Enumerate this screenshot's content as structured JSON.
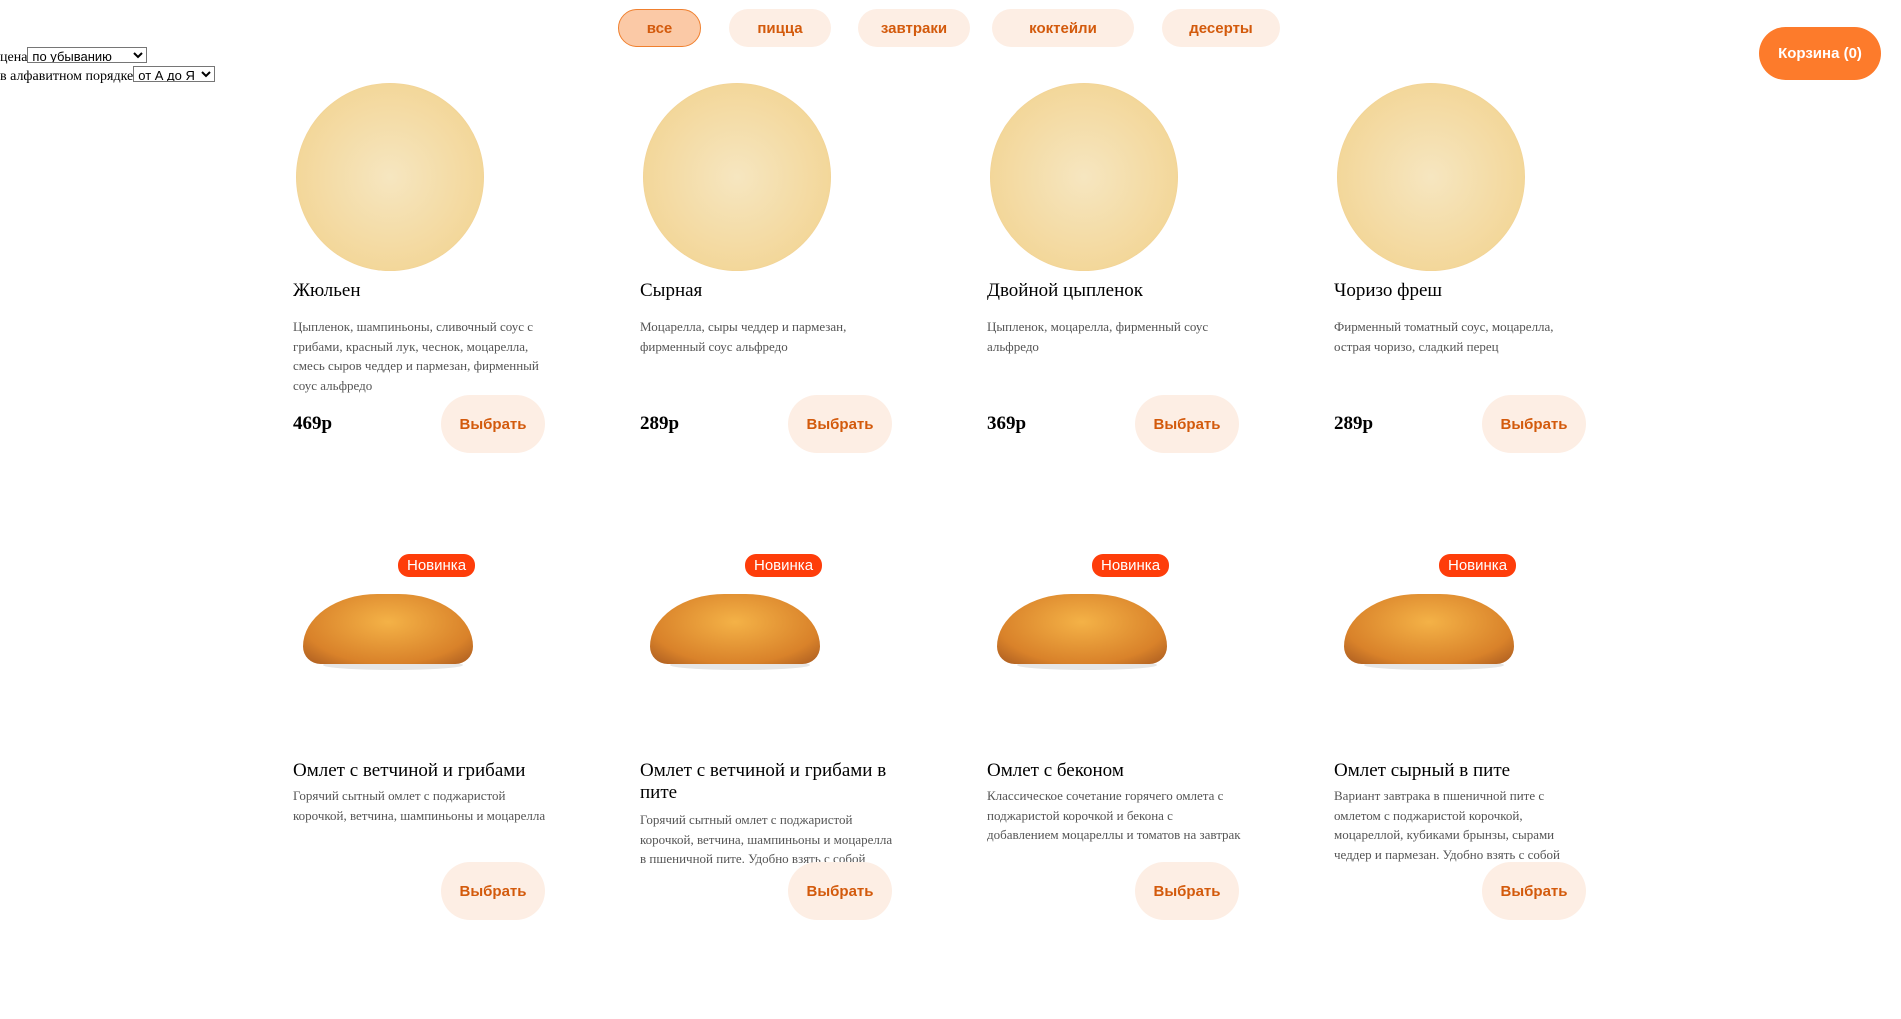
{
  "tabs": [
    {
      "label": "все",
      "active": true
    },
    {
      "label": "пицца"
    },
    {
      "label": "завтраки"
    },
    {
      "label": "коктейли"
    },
    {
      "label": "десерты"
    }
  ],
  "cart": {
    "label": "Корзина (0)"
  },
  "sort": {
    "price_label": "цена",
    "price_value": "по убыванию",
    "alpha_label": "в алфавитном порядке",
    "alpha_value": "от А до Я"
  },
  "colors": {
    "accent": "#fd7b2b",
    "button_bg": "#fdeee4",
    "button_text": "#d35a0c",
    "badge": "#fe3d0a"
  },
  "products": [
    {
      "title": "Жюльен",
      "desc": "Цыпленок, шампиньоны, сливочный соус с грибами, красный лук, чеснок, моцарелла, смесь сыров чеддер и пармезан, фирменный соус альфредо",
      "price": "469р",
      "button": "Выбрать",
      "image": "pizza"
    },
    {
      "title": "Сырная",
      "desc": "Моцарелла, сыры чеддер и пармезан, фирменный соус альфредо",
      "price": "289р",
      "button": "Выбрать",
      "image": "pizza"
    },
    {
      "title": "Двойной цыпленок",
      "desc": "Цыпленок, моцарелла, фирменный соус альфредо",
      "price": "369р",
      "button": "Выбрать",
      "image": "pizza"
    },
    {
      "title": "Чоризо фреш",
      "desc": "Фирменный томатный соус, моцарелла, острая чоризо, сладкий перец",
      "price": "289р",
      "button": "Выбрать",
      "image": "pizza"
    },
    {
      "title": "Омлет с ветчиной и грибами",
      "desc": "Горячий сытный омлет с поджаристой корочкой, ветчина, шампиньоны и моцарелла",
      "badge": "Новинка",
      "button": "Выбрать",
      "image": "omelet"
    },
    {
      "title": "Омлет с ветчиной и грибами в пите",
      "desc": "Горячий сытный омлет с поджаристой корочкой, ветчина, шампиньоны и моцарелла в пшеничной пите. Удобно взять с собой",
      "badge": "Новинка",
      "button": "Выбрать",
      "image": "omelet"
    },
    {
      "title": "Омлет с беконом",
      "desc": "Классическое сочетание горячего омлета с поджаристой корочкой и бекона с добавлением моцареллы и томатов на завтрак",
      "badge": "Новинка",
      "button": "Выбрать",
      "image": "omelet"
    },
    {
      "title": "Омлет сырный в пите",
      "desc": "Вариант завтрака в пшеничной пите с омлетом с поджаристой корочкой, моцареллой, кубиками брынзы, сырами чеддер и пармезан. Удобно взять с собой",
      "badge": "Новинка",
      "button": "Выбрать",
      "image": "omelet"
    }
  ]
}
